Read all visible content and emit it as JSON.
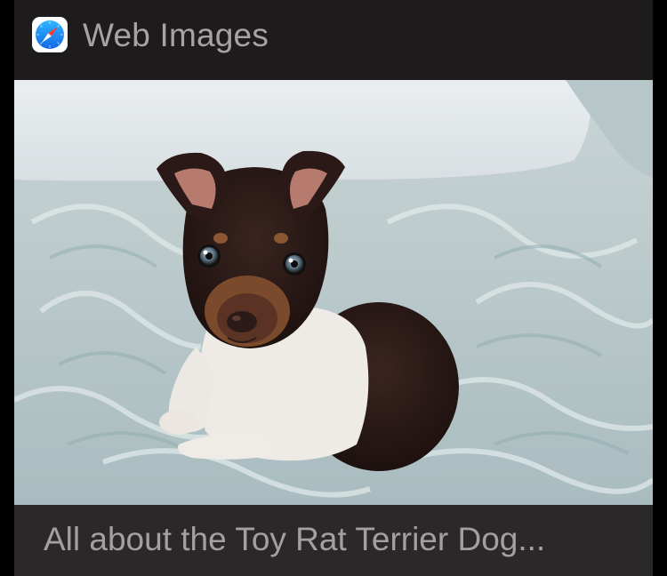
{
  "card": {
    "source_icon": "safari-compass-icon",
    "source_label": "Web Images",
    "image": {
      "subject": "puppy-photo",
      "alt": "puppy-photo"
    },
    "caption": "All about the Toy Rat Terrier Dog..."
  },
  "colors": {
    "card_background": "#1c1a1a",
    "caption_background": "#2a2828",
    "text_secondary": "#a7a3a4",
    "safari_blue": "#1a8cf0"
  }
}
